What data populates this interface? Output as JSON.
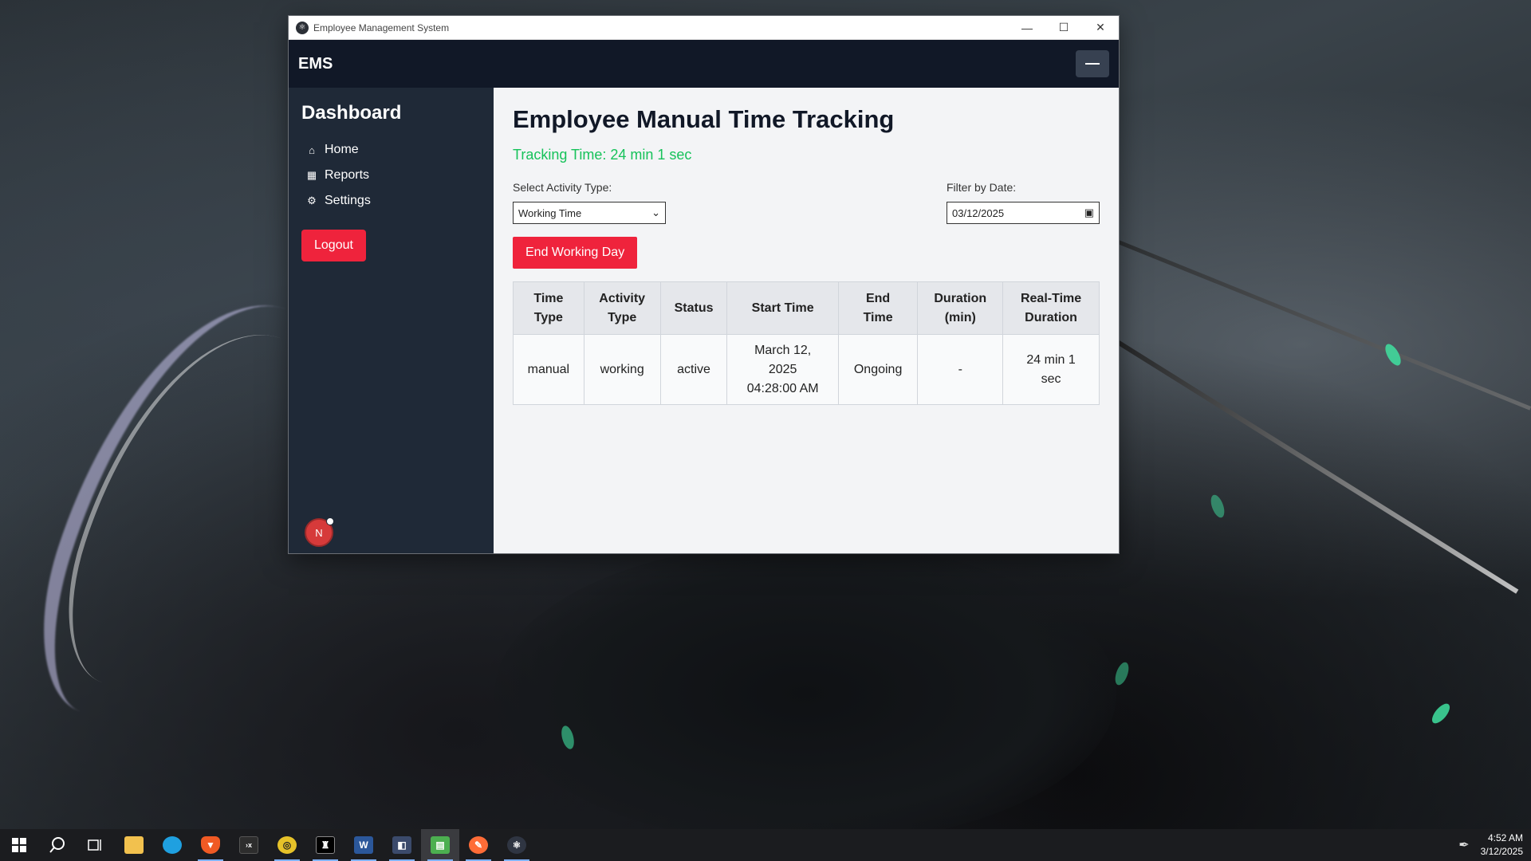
{
  "window": {
    "title": "Employee Management System",
    "controls": {
      "minimize": "—",
      "maximize": "☐",
      "close": "✕"
    }
  },
  "topnav": {
    "brand": "EMS"
  },
  "sidebar": {
    "heading": "Dashboard",
    "items": [
      {
        "label": "Home",
        "icon": "home-icon",
        "glyph": "⌂"
      },
      {
        "label": "Reports",
        "icon": "chart-icon",
        "glyph": "▦"
      },
      {
        "label": "Settings",
        "icon": "gear-icon",
        "glyph": "⚙"
      }
    ],
    "logout_label": "Logout",
    "avatar_initial": "N"
  },
  "main": {
    "title": "Employee Manual Time Tracking",
    "tracking_text": "Tracking Time: 24 min 1 sec",
    "activity": {
      "label": "Select Activity Type:",
      "selected": "Working Time"
    },
    "date_filter": {
      "label": "Filter by Date:",
      "value": "03/12/2025"
    },
    "end_button_label": "End Working Day",
    "table": {
      "headers": [
        [
          "Time",
          "Type"
        ],
        [
          "Activity",
          "Type"
        ],
        [
          "Status"
        ],
        [
          "Start Time"
        ],
        [
          "End",
          "Time"
        ],
        [
          "Duration",
          "(min)"
        ],
        [
          "Real-Time",
          "Duration"
        ]
      ],
      "rows": [
        {
          "time_type": "manual",
          "activity_type": "working",
          "status": "active",
          "start_line1": "March 12,",
          "start_line2": "2025",
          "start_line3": "04:28:00 AM",
          "end_time": "Ongoing",
          "duration": "-",
          "realtime_line1": "24 min 1",
          "realtime_line2": "sec"
        }
      ]
    }
  },
  "taskbar": {
    "items": [
      "windows-start-icon",
      "search-icon",
      "task-view-icon",
      "file-explorer-icon",
      "edge-icon",
      "brave-icon",
      "terminal-icon",
      "chat-app-icon",
      "game-icon",
      "word-icon",
      "visual-studio-icon",
      "sheets-icon",
      "postman-icon",
      "electron-app-icon"
    ],
    "time": "4:52 AM",
    "date": "3/12/2025"
  }
}
